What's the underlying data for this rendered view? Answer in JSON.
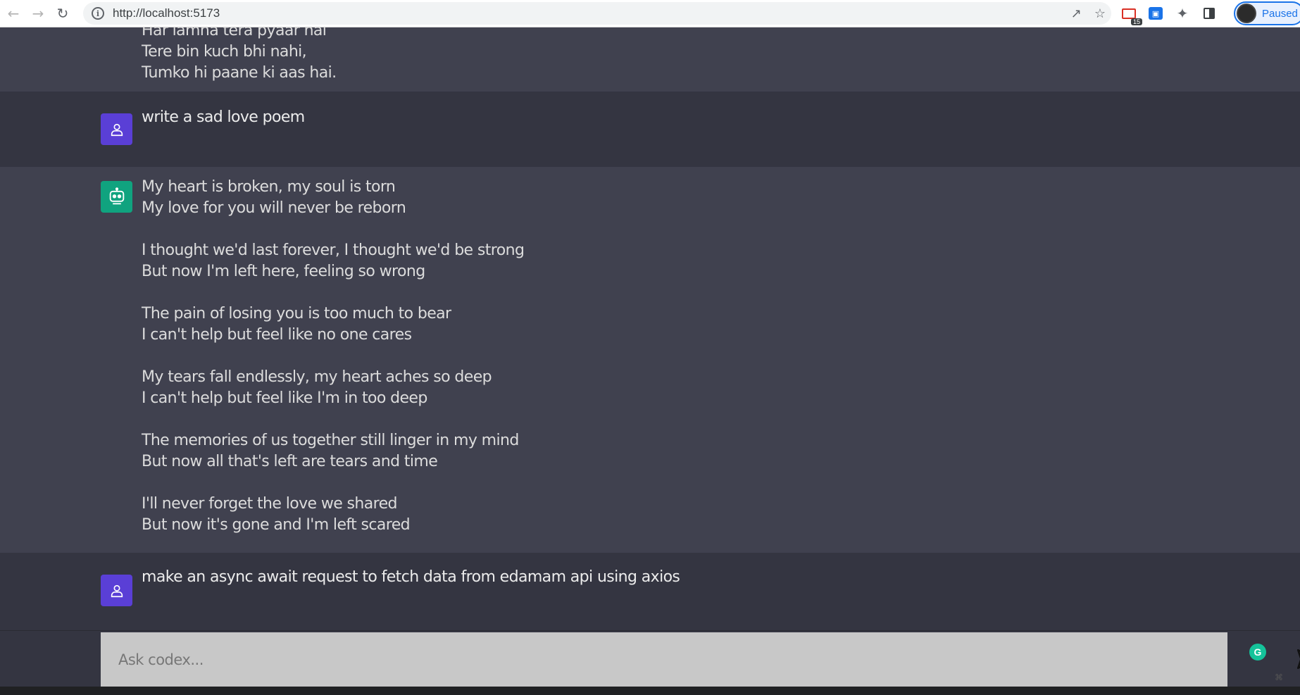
{
  "browser": {
    "url": "http://localhost:5173",
    "extension_badge": "15",
    "profile_status": "Paused"
  },
  "chat": {
    "partial_bot": {
      "clipped_line": "Har lamha tera pyaar hai",
      "lines": "Tere bin kuch bhi nahi,\nTumko hi paane ki aas hai."
    },
    "user_message_1": "write a sad love poem",
    "bot_message": " My heart is broken, my soul is torn\nMy love for you will never be reborn\n\nI thought we'd last forever, I thought we'd be strong\nBut now I'm left here, feeling so wrong\n\nThe pain of losing you is too much to bear\nI can't help but feel like no one cares\n\nMy tears fall endlessly, my heart aches so deep\nI can't help but feel like I'm in too deep\n\nThe memories of us together still linger in my mind\nBut now all that's left are tears and time\n\nI'll never forget the love we shared\nBut now it's gone and I'm left scared",
    "user_message_2": "make an async await request to fetch data from edamam api using axios"
  },
  "input": {
    "placeholder": "Ask codex...",
    "value": ""
  },
  "colors": {
    "user_bg": "#343541",
    "bot_bg": "#40414f",
    "user_avatar": "#5a3fd6",
    "bot_avatar": "#10a37f",
    "input_bg": "#c8c8c8"
  }
}
